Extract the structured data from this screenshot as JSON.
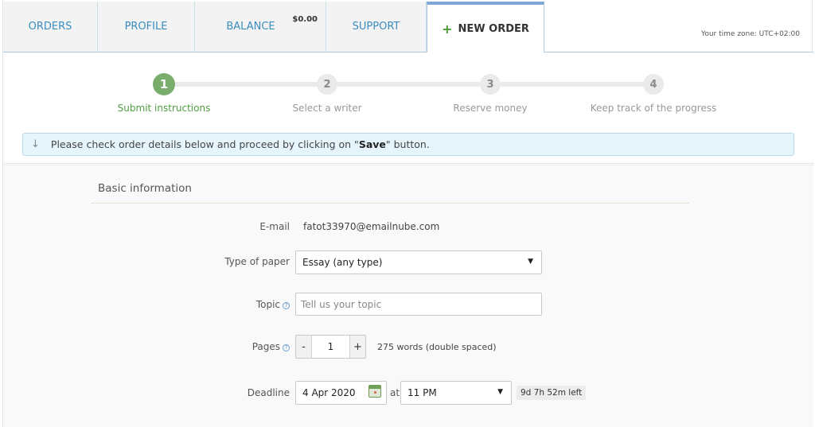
{
  "tabs": {
    "orders": "ORDERS",
    "profile": "PROFILE",
    "balance": "BALANCE",
    "balance_amount": "$0.00",
    "support": "SUPPORT",
    "new_order_icon": "+",
    "new_order": "NEW ORDER",
    "timezone": "Your time zone: UTC+02:00"
  },
  "steps": [
    {
      "number": "1",
      "label": "Submit instructions",
      "active": true
    },
    {
      "number": "2",
      "label": "Select a writer",
      "active": false
    },
    {
      "number": "3",
      "label": "Reserve money",
      "active": false
    },
    {
      "number": "4",
      "label": "Keep track of the progress",
      "active": false
    }
  ],
  "notice": {
    "icon": "arrow-down-icon",
    "text_before": "Please check order details below and proceed by clicking on \"",
    "bold": "Save",
    "text_after": "\" button."
  },
  "form": {
    "section_title": "Basic information",
    "email_label": "E-mail",
    "email_value": "fatot33970@emailnube.com",
    "paper_type_label": "Type of paper",
    "paper_type_value": "Essay (any type)",
    "topic_label": "Topic",
    "topic_placeholder": "Tell us your topic",
    "topic_value": "",
    "pages_label": "Pages",
    "pages_minus": "-",
    "pages_value": "1",
    "pages_plus": "+",
    "pages_words": "275 words (double spaced)",
    "deadline_label": "Deadline",
    "deadline_date": "4 Apr 2020",
    "deadline_at": "at",
    "deadline_time": "11 PM",
    "deadline_left": "9d 7h 52m left",
    "help_glyph": "?",
    "caret_glyph": "▼"
  },
  "colors": {
    "accent_blue": "#3a8dc0",
    "active_green": "#79ad6b",
    "notice_bg": "#e6f5fc"
  }
}
